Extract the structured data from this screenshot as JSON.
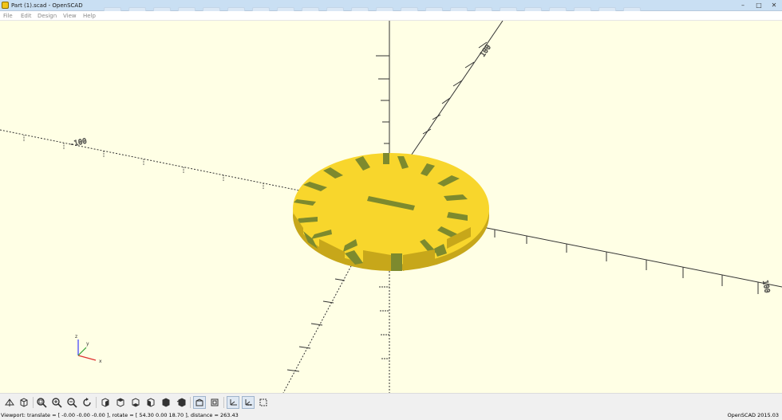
{
  "window": {
    "title": "Part (1).scad - OpenSCAD",
    "minimize_glyph": "–",
    "maximize_glyph": "□",
    "close_glyph": "✕"
  },
  "menu": {
    "items": [
      "File",
      "Edit",
      "Design",
      "View",
      "Help"
    ]
  },
  "viewport": {
    "background_color": "#ffffe5",
    "model_color": "#f8d62c",
    "model_shadow_color": "#7d8a2e",
    "axis_labels": {
      "x_positive": "100",
      "x_negative": "-100",
      "y_positive": "100",
      "gizmo_x": "x",
      "gizmo_y": "y",
      "gizmo_z": "z"
    }
  },
  "toolbar": {
    "buttons": [
      {
        "name": "preview-icon",
        "active": false
      },
      {
        "name": "render-icon",
        "active": false
      },
      {
        "name": "view-all-icon",
        "active": false
      },
      {
        "name": "zoom-in-icon",
        "active": false
      },
      {
        "name": "zoom-out-icon",
        "active": false
      },
      {
        "name": "reset-view-icon",
        "active": false
      },
      {
        "name": "view-right-icon",
        "active": false
      },
      {
        "name": "view-top-icon",
        "active": false
      },
      {
        "name": "view-bottom-icon",
        "active": false
      },
      {
        "name": "view-left-icon",
        "active": false
      },
      {
        "name": "view-front-icon",
        "active": false
      },
      {
        "name": "perspective-icon",
        "active": true
      },
      {
        "name": "orthogonal-icon",
        "active": false
      },
      {
        "name": "show-axes-icon",
        "active": true
      },
      {
        "name": "show-scale-markers-icon",
        "active": true
      },
      {
        "name": "show-edges-icon",
        "active": false
      }
    ]
  },
  "status": {
    "viewport_text": "Viewport: translate = [ -0.00 -0.00 -0.00 ], rotate = [ 54.30 0.00 18.70 ], distance = 263.43",
    "version_text": "OpenSCAD 2015.03"
  }
}
